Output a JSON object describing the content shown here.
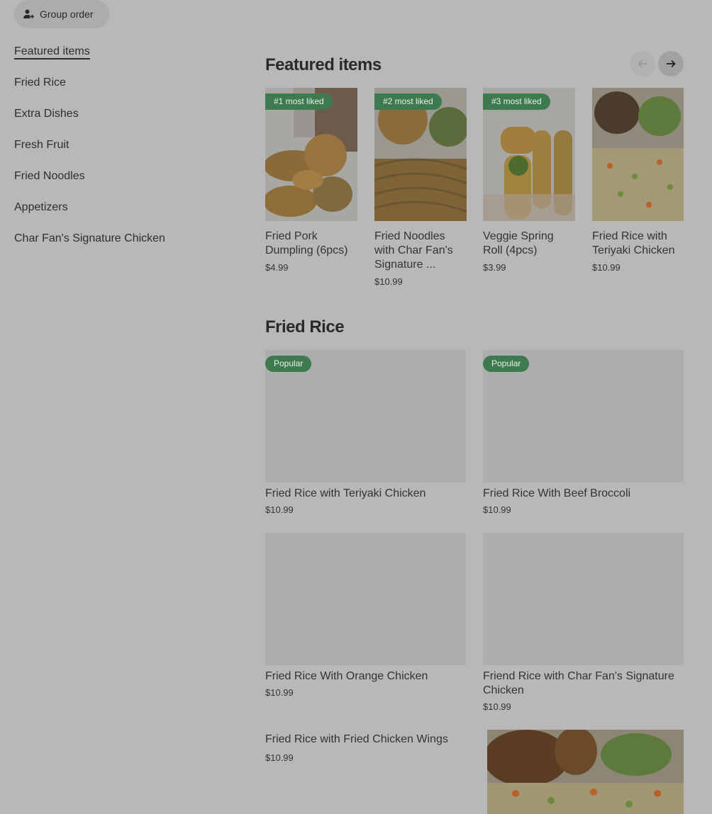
{
  "group_order": {
    "label": "Group order",
    "icon": "person-plus-icon"
  },
  "sidebar": {
    "items": [
      {
        "label": "Featured items",
        "active": true
      },
      {
        "label": "Fried Rice"
      },
      {
        "label": "Extra Dishes"
      },
      {
        "label": "Fresh Fruit"
      },
      {
        "label": "Fried Noodles"
      },
      {
        "label": "Appetizers"
      },
      {
        "label": "Char Fan's Signature Chicken"
      }
    ]
  },
  "featured": {
    "title": "Featured items",
    "prev_icon": "arrow-left-icon",
    "next_icon": "arrow-right-icon",
    "items": [
      {
        "badge": "#1 most liked",
        "name": "Fried Pork Dumpling (6pcs)",
        "price": "$4.99"
      },
      {
        "badge": "#2 most liked",
        "name": "Fried Noodles with Char Fan's Signature ...",
        "price": "$10.99"
      },
      {
        "badge": "#3 most liked",
        "name": "Veggie Spring Roll (4pcs)",
        "price": "$3.99"
      },
      {
        "badge": "",
        "name": "Fried Rice with Teriyaki Chicken",
        "price": "$10.99"
      }
    ]
  },
  "fried_rice": {
    "title": "Fried Rice",
    "items": [
      {
        "badge": "Popular",
        "name": "Fried Rice with Teriyaki Chicken",
        "price": "$10.99"
      },
      {
        "badge": "Popular",
        "name": "Fried Rice With Beef Broccoli",
        "price": "$10.99"
      },
      {
        "badge": "",
        "name": "Fried Rice With Orange Chicken",
        "price": "$10.99"
      },
      {
        "badge": "",
        "name": "Friend Rice with Char Fan's Signature Chicken",
        "price": "$10.99"
      },
      {
        "badge": "",
        "name": "Fried Rice with Fried Chicken Wings",
        "price": "$10.99"
      }
    ]
  },
  "colors": {
    "background": "#b8b8b8",
    "badge": "#3d7a4f",
    "text": "#2a2a2a"
  }
}
